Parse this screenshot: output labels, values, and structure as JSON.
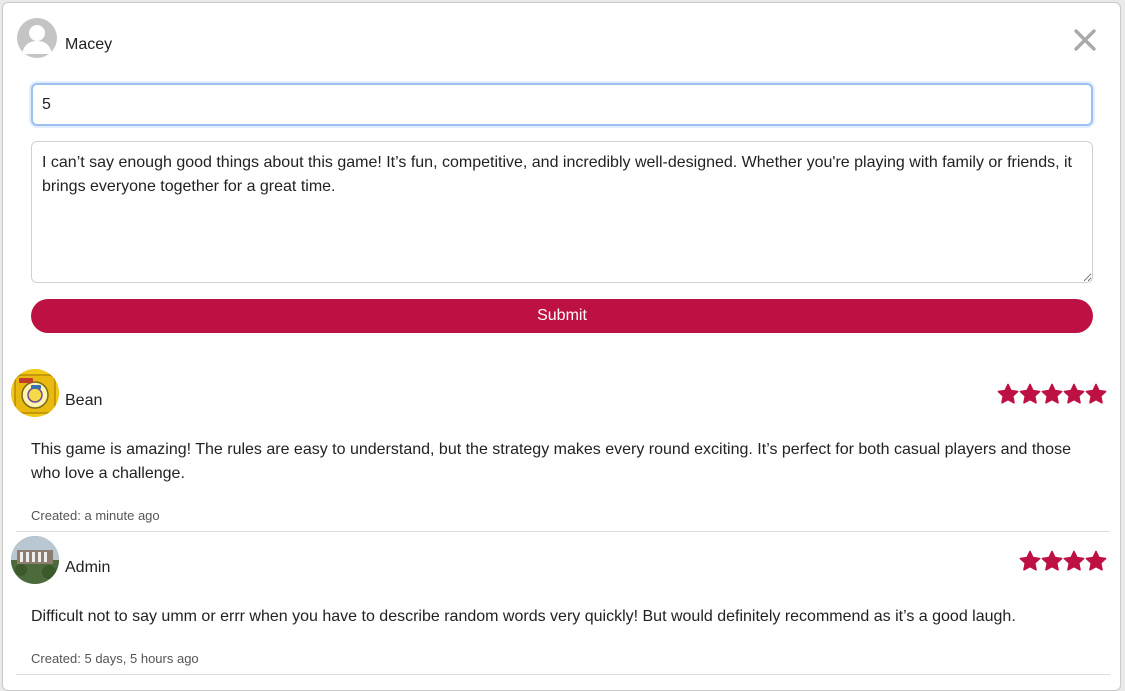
{
  "current_user": {
    "name": "Macey",
    "avatar_icon": "user-silhouette-icon"
  },
  "close_icon": "close-icon",
  "form": {
    "rating_value": "5",
    "review_text": "I can’t say enough good things about this game! It’s fun, competitive, and incredibly well-designed. Whether you're playing with family or friends, it brings everyone together for a great time.",
    "submit_label": "Submit"
  },
  "colors": {
    "accent": "#be1143",
    "star": "#be1143",
    "focus_border": "#9cc0f0"
  },
  "reviews": [
    {
      "author": "Bean",
      "rating": 5,
      "text": "This game is amazing! The rules are easy to understand, but the strategy makes every round exciting. It’s perfect for both casual players and those who love a challenge.",
      "created": "Created: a minute ago"
    },
    {
      "author": "Admin",
      "rating": 4,
      "text": "Difficult not to say umm or errr when you have to describe random words very quickly! But would definitely recommend as it’s a good laugh.",
      "created": "Created: 5 days, 5 hours ago"
    }
  ]
}
